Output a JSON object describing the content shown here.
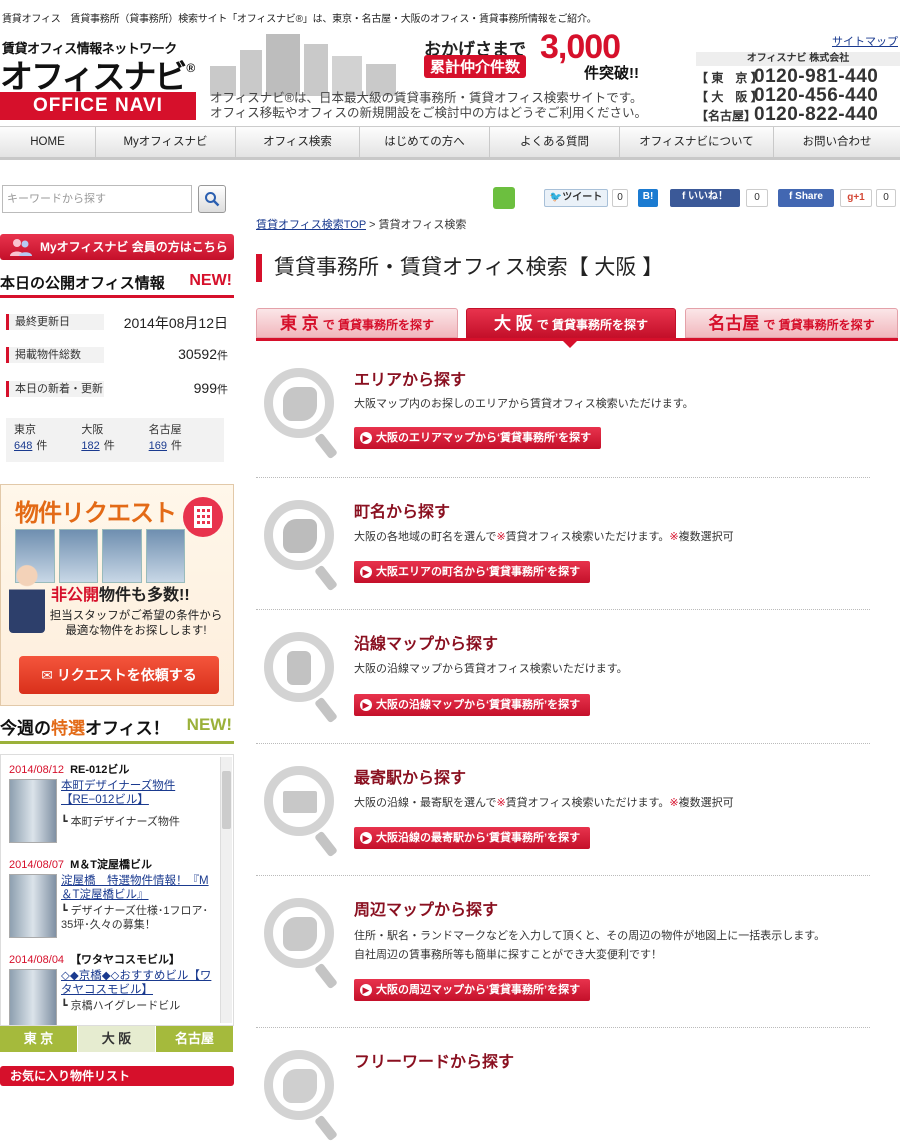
{
  "header": {
    "topline": "賃貸オフィス　賃貸事務所（貸事務所）検索サイト「オフィスナビ®」は、東京・名古屋・大阪のオフィス・賃貸事務所情報をご紹介。",
    "sitemap": "サイトマップ",
    "brand_sub": "賃貸オフィス情報ネットワーク",
    "brand_main": "オフィスナビ",
    "brand_reg": "®",
    "brand_en": "OFFICE NAVI",
    "desc_line1": "オフィスナビ®は、日本最大級の賃貸事務所・賃貸オフィス検索サイトです。",
    "desc_line2": "オフィス移転やオフィスの新規開設をご検討中の方はどうぞご利用ください。",
    "campaign": {
      "line1": "おかげさまで",
      "badge": "累計仲介件数",
      "number": "3,000",
      "suffix": "件突破!!"
    },
    "company": "オフィスナビ 株式会社",
    "phones": [
      {
        "city": "【 東　京 】",
        "number": "0120-981-440"
      },
      {
        "city": "【 大　阪 】",
        "number": "0120-456-440"
      },
      {
        "city": "【名古屋】",
        "number": "0120-822-440"
      }
    ]
  },
  "nav": [
    "HOME",
    "Myオフィスナビ",
    "オフィス検索",
    "はじめての方へ",
    "よくある質問",
    "オフィスナビについて",
    "お問い合わせ"
  ],
  "sidebar": {
    "search_placeholder": "キーワードから探す",
    "my_office": "Myオフィスナビ 会員の方はこちら",
    "today_title": "本日の公開オフィス情報",
    "today_new": "NEW!",
    "stats": [
      {
        "label": "最終更新日",
        "value": "2014年08月12日"
      },
      {
        "label": "掲載物件総数",
        "value": "30592",
        "unit": "件"
      },
      {
        "label": "本日の新着・更新",
        "value": "999",
        "unit": "件"
      }
    ],
    "cities": [
      {
        "name": "東京",
        "count": "648",
        "unit": "件"
      },
      {
        "name": "大阪",
        "count": "182",
        "unit": "件"
      },
      {
        "name": "名古屋",
        "count": "169",
        "unit": "件"
      }
    ],
    "request": {
      "title": "物件リクエスト",
      "sub_hl": "非公開",
      "sub": "物件も多数!!",
      "text1": "担当スタッフがご希望の条件から",
      "text2": "最適な物件をお探しします!",
      "button": "リクエストを依頼する"
    },
    "week_title_pre": "今週の",
    "week_title_hl": "特選",
    "week_title_post": "オフィス！",
    "week_new": "NEW!",
    "features": [
      {
        "date": "2014/08/12",
        "name": "RE-012ビル",
        "link": "本町デザイナーズ物件【RE−012ビル】",
        "sub": "┗ 本町デザイナーズ物件"
      },
      {
        "date": "2014/08/07",
        "name": "M＆T淀屋橋ビル",
        "link": "淀屋橋　特選物件情報！『M＆T淀屋橋ビル』",
        "sub": "┗ デザイナーズ仕様･1フロア･35坪･久々の募集！"
      },
      {
        "date": "2014/08/04",
        "name": "【ワタヤコスモビル】",
        "link": "◇◆京橋◆◇おすすめビル【ワタヤコスモビル】",
        "sub": "┗ 京橋ハイグレードビル"
      }
    ],
    "city_tabs": [
      "東 京",
      "大 阪",
      "名古屋"
    ],
    "fav": "お気に入り物件リスト"
  },
  "social": {
    "tweet": "ツイート",
    "tweet_count": "0",
    "hatena": "B!",
    "hatena_count": "0",
    "like": "いいね！",
    "like_count": "0",
    "share": "Share",
    "gplus": "+1",
    "gplus_count": "0"
  },
  "breadcrumb": {
    "home": "賃貸オフィス検索TOP",
    "sep": " > ",
    "current": "賃貸オフィス検索"
  },
  "page_title": "賃貸事務所・賃貸オフィス検索【 大阪 】",
  "city_tabs": [
    {
      "city": "東 京",
      "rest": "で 賃貸事務所を探す",
      "active": false
    },
    {
      "city": "大 阪",
      "rest": "で 賃貸事務所を探す",
      "active": true
    },
    {
      "city": "名古屋",
      "rest": "で 賃貸事務所を探す",
      "active": false
    }
  ],
  "sections": [
    {
      "title": "エリアから探す",
      "desc1": "大阪マップ内のお探しのエリアから賃貸オフィス検索いただけます。",
      "button": "大阪のエリアマップから‘賃貸事務所’を探す"
    },
    {
      "title": "町名から探す",
      "desc1_a": "大阪の各地域の町名を選んで",
      "desc1_m": "※",
      "desc1_b": "賃貸オフィス検索いただけます。",
      "desc1_m2": "※",
      "desc1_c": "複数選択可",
      "button": "大阪エリアの町名から‘賃貸事務所’を探す"
    },
    {
      "title": "沿線マップから探す",
      "desc1": "大阪の沿線マップから賃貸オフィス検索いただけます。",
      "button": "大阪の沿線マップから‘賃貸事務所’を探す"
    },
    {
      "title": "最寄駅から探す",
      "desc1_a": "大阪の沿線・最寄駅を選んで",
      "desc1_m": "※",
      "desc1_b": "賃貸オフィス検索いただけます。",
      "desc1_m2": "※",
      "desc1_c": "複数選択可",
      "button": "大阪沿線の最寄駅から‘賃貸事務所’を探す"
    },
    {
      "title": "周辺マップから探す",
      "desc1": "住所・駅名・ランドマークなどを入力して頂くと、その周辺の物件が地図上に一括表示します。",
      "desc2": "自社周辺の賃事務所等も簡単に探すことができ大変便利です！",
      "button": "大阪の周辺マップから‘賃貸事務所’を探す"
    },
    {
      "title": "フリーワードから探す"
    }
  ],
  "colors": {
    "accent": "#d6102b",
    "green": "#9bb13a",
    "orange": "#e36a16"
  }
}
